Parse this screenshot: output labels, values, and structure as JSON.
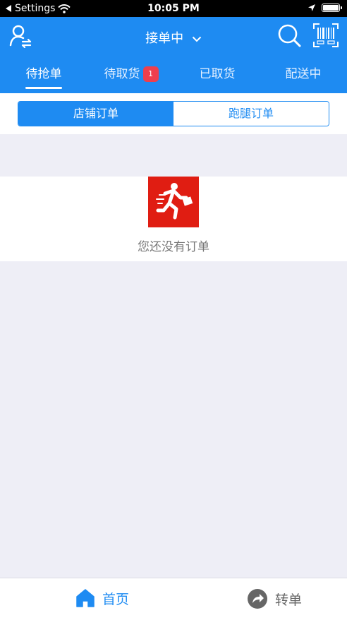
{
  "status_bar": {
    "back_label": "Settings",
    "time": "10:05 PM"
  },
  "header": {
    "title": "接单中"
  },
  "tabs": [
    {
      "label": "待抢单"
    },
    {
      "label": "待取货",
      "badge": "1"
    },
    {
      "label": "已取货"
    },
    {
      "label": "配送中"
    }
  ],
  "segment": {
    "store_orders": "店铺订单",
    "errand_orders": "跑腿订单"
  },
  "empty_state": {
    "message": "您还没有订单"
  },
  "tabbar": {
    "home": "首页",
    "transfer": "转单"
  },
  "colors": {
    "primary": "#1e8bf2",
    "badge": "#ee3f4d",
    "empty_icon_bg": "#e01d12",
    "page_bg": "#eeeef6"
  },
  "icons": [
    "back-arrow-icon",
    "wifi-icon",
    "location-arrow-icon",
    "battery-icon",
    "user-switch-icon",
    "chevron-down-icon",
    "search-icon",
    "barcode-scan-icon",
    "running-courier-icon",
    "home-icon",
    "share-arrow-icon"
  ]
}
